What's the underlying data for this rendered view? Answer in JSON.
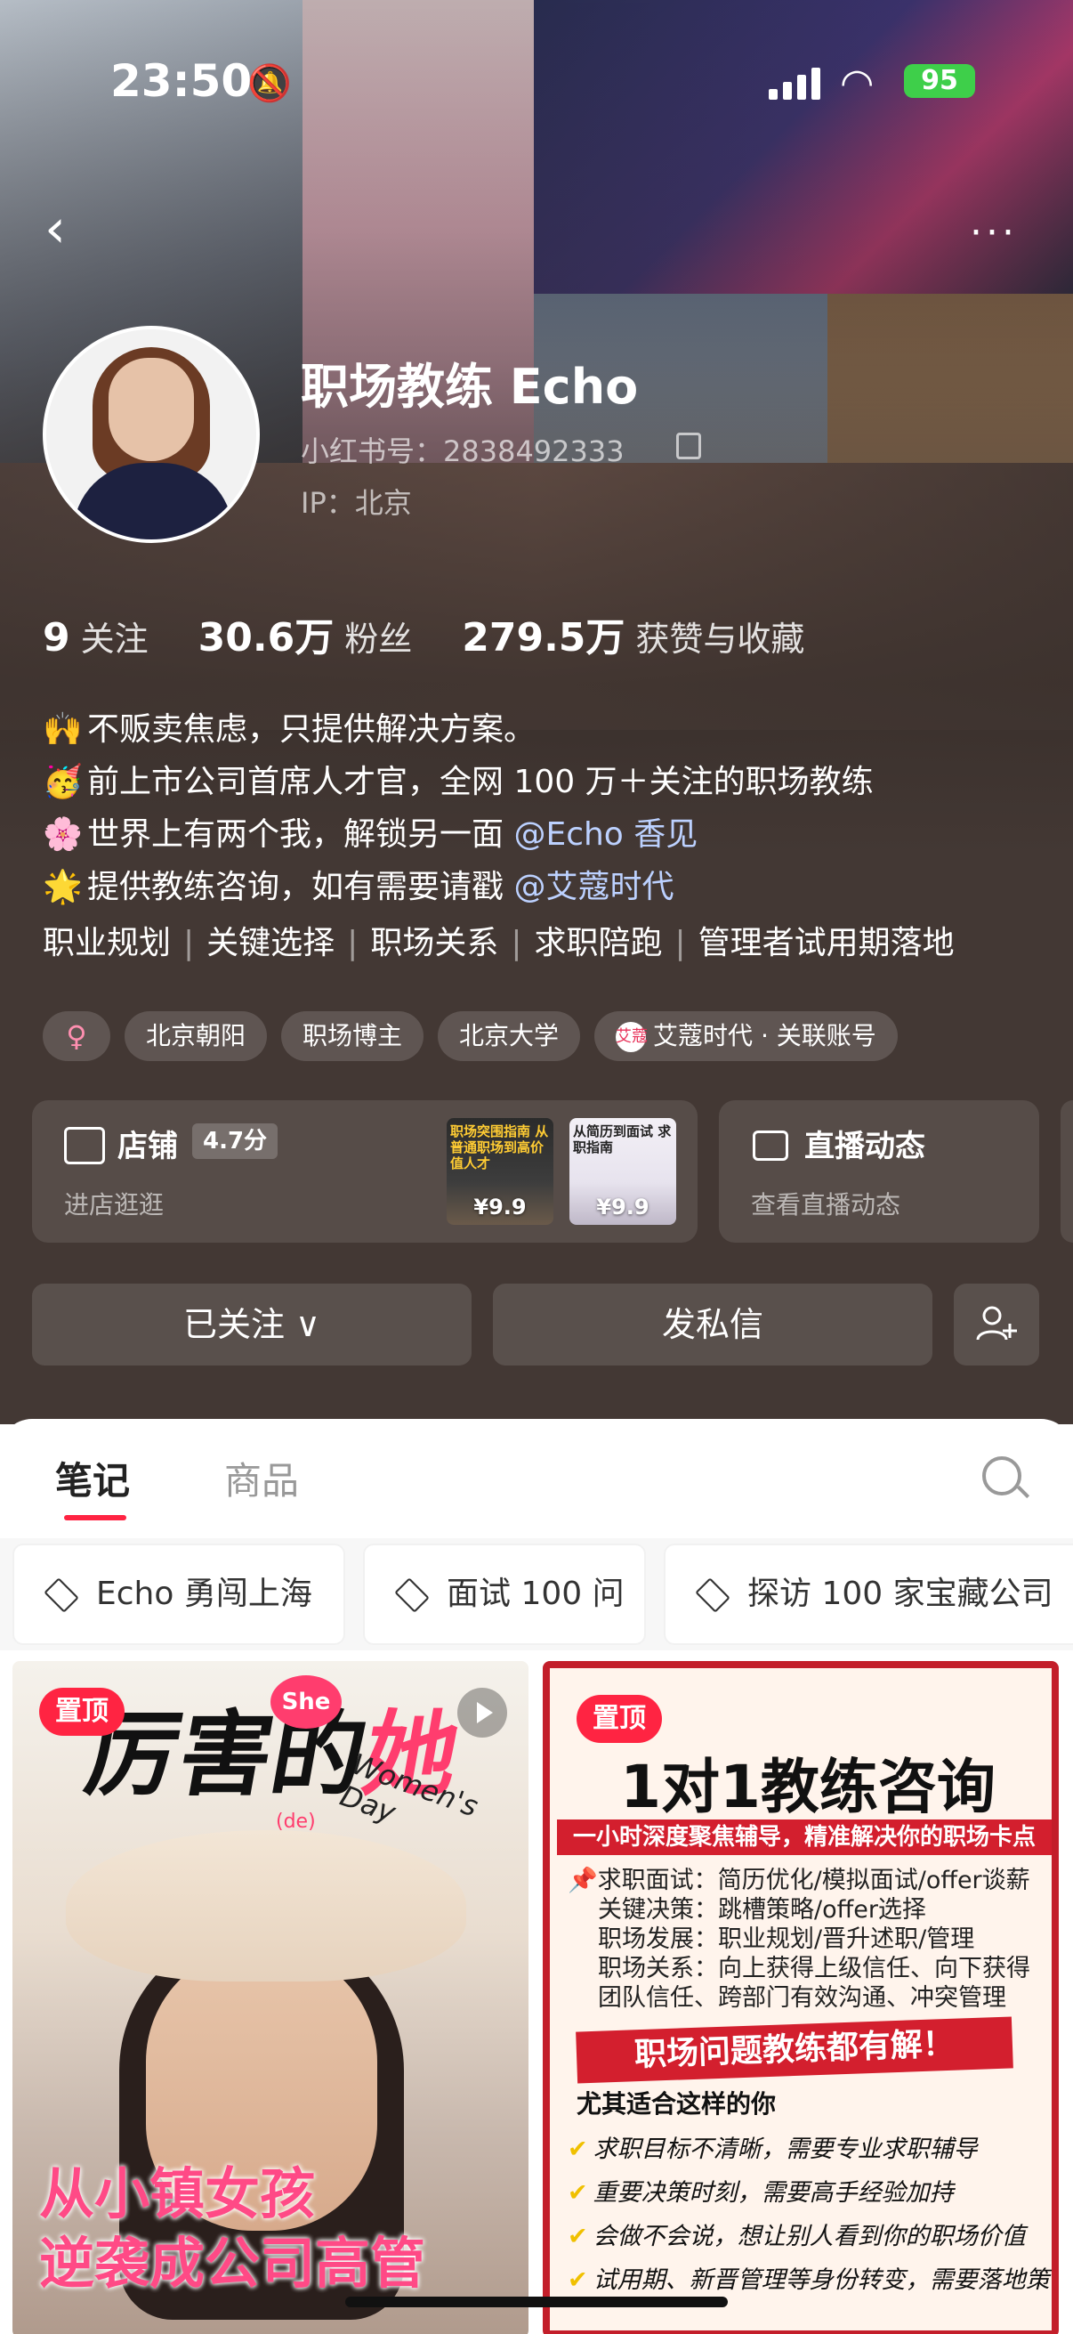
{
  "status_bar": {
    "time": "23:50",
    "battery": "95"
  },
  "profile": {
    "name": "职场教练 Echo",
    "xhs_id": "小红书号：2838492333",
    "ip": "IP：北京",
    "stats": [
      {
        "value": "9",
        "label": "关注"
      },
      {
        "value": "30.6万",
        "label": "粉丝"
      },
      {
        "value": "279.5万",
        "label": "获赞与收藏"
      }
    ],
    "bio": {
      "line1_emoji": "🙌",
      "line1": "不贩卖焦虑，只提供解决方案。",
      "line2_emoji": "🥳",
      "line2": "前上市公司首席人才官，全网 100 万＋关注的职场教练",
      "line3_emoji": "🌸",
      "line3": "世界上有两个我，解锁另一面 ",
      "line3_mention": "@Echo 香见",
      "line4_emoji": "🌟",
      "line4": "提供教练咨询，如有需要请戳 ",
      "line4_mention": "@艾蔻时代"
    },
    "topics": [
      "职业规划",
      "关键选择",
      "职场关系",
      "求职陪跑",
      "管理者试用期落地"
    ],
    "chips": {
      "gender": "♀",
      "location": "北京朝阳",
      "role": "职场博主",
      "school": "北京大学",
      "linked_logo": "艾蔻",
      "linked": "艾蔻时代 · 关联账号"
    }
  },
  "shop": {
    "title": "店铺",
    "rating": "4.7分",
    "subtitle": "进店逛逛",
    "products": [
      {
        "title": "职场突围指南 从普通职场到高价值人才",
        "price": "¥9.9"
      },
      {
        "title": "从简历到面试 求职指南",
        "price": "¥9.9"
      }
    ]
  },
  "live": {
    "title": "直播动态",
    "subtitle": "查看直播动态"
  },
  "actions": {
    "followed": "已关注 ∨",
    "message": "发私信",
    "add_friend_icon": "add-user-icon"
  },
  "tabs": {
    "notes": "笔记",
    "goods": "商品"
  },
  "collections": [
    "Echo 勇闯上海",
    "面试 100 问",
    "探访 100 家宝藏公司"
  ],
  "posts": [
    {
      "pin": "置顶",
      "title": "厉害的",
      "she": "She",
      "de": "(de)",
      "her": "她",
      "women": "Women's Day",
      "subtitle_line1": "从小镇女孩",
      "subtitle_line2": "逆袭成公司高管"
    },
    {
      "pin": "置顶",
      "title": "1对1教练咨询",
      "band": "一小时深度聚焦辅导，精准解决你的职场卡点",
      "items": [
        "求职面试：简历优化/模拟面试/offer谈薪",
        "关键决策：跳槽策略/offer选择",
        "职场发展：职业规划/晋升述职/管理",
        "职场关系：向上获得上级信任、向下获得",
        "团队信任、跨部门有效沟通、冲突管理"
      ],
      "banner": "职场问题教练都有解！",
      "small": "尤其适合这样的你",
      "checks": [
        "求职目标不清晰，需要专业求职辅导",
        "重要决策时刻，需要高手经验加持",
        "会做不会说，想让别人看到你的职场价值",
        "试用期、新晋管理等身份转变，需要落地策略"
      ]
    }
  ],
  "colors": {
    "accent": "#ff2442",
    "mention": "#bcd1ff",
    "battery": "#3ecf4a"
  }
}
